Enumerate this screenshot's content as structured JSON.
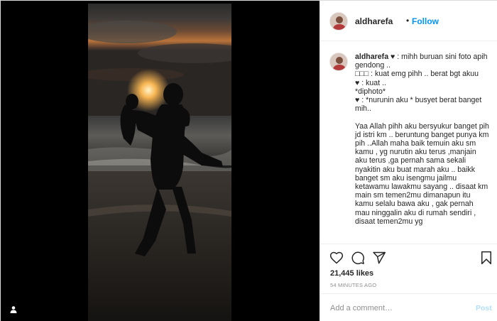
{
  "post": {
    "username": "aldharefa",
    "dot": "•",
    "follow_label": "Follow",
    "caption_user": "aldharefa",
    "caption_text": " ♥ : mihh buruan sini foto apih gendong ..\n□□□ : kuat emg pihh .. berat bgt akuu\n♥ : kuat ..\n*diphoto*\n♥ : *nurunin aku * busyet berat banget mih..\n\nYaa Allah pihh aku bersyukur banget pih jd istri km .. beruntung banget punya km pih ..Allah maha baik temuin aku sm kamu , yg nurutin aku terus ,manjain aku terus ,ga pernah sama sekali nyakitin aku buat marah aku .. baikk banget sm aku isengmu jailmu ketawamu lawakmu sayang .. disaat km main sm temen2mu dimanapun itu kamu selalu bawa aku , gak pernah mau ninggalin aku di rumah sendiri , disaat temen2mu yg",
    "likes": "21,445 likes",
    "timestamp": "54 MINUTES AGO"
  },
  "comment_box": {
    "placeholder": "Add a comment…",
    "post_label": "Post"
  },
  "icons": {
    "like": "heart-icon",
    "comment": "comment-bubble-icon",
    "share": "paper-plane-icon",
    "save": "bookmark-icon",
    "tag": "user-tag-icon"
  },
  "colors": {
    "accent": "#0095f6",
    "post_disabled": "#b2dffc",
    "muted": "#8e8e8e",
    "text": "#262626"
  }
}
